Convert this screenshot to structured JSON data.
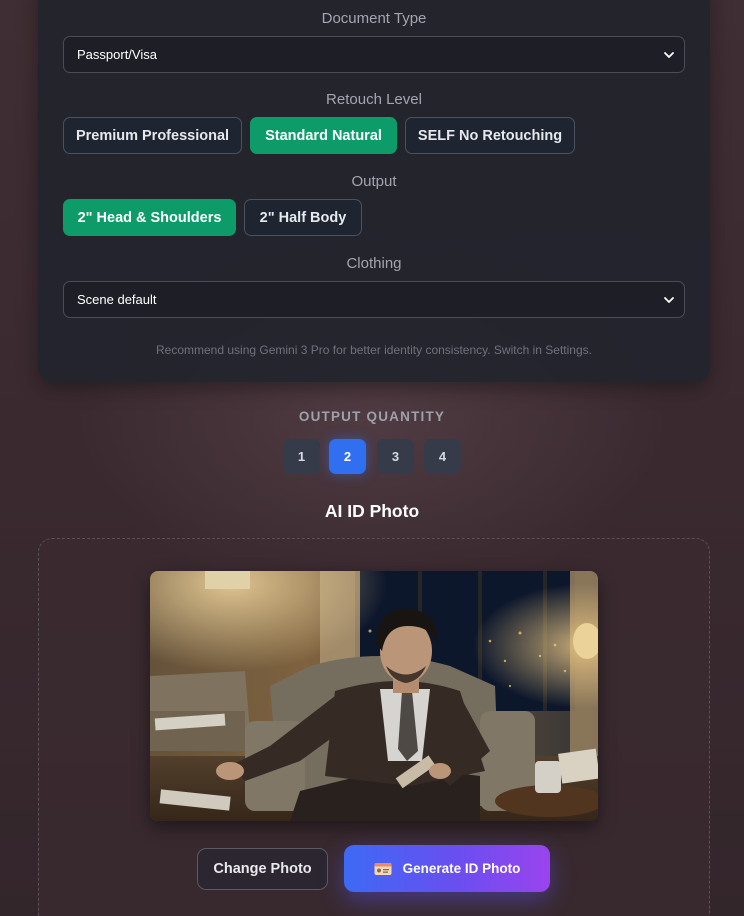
{
  "document_type": {
    "label": "Document Type",
    "selected": "Passport/Visa"
  },
  "retouch": {
    "label": "Retouch Level",
    "options": [
      "Premium Professional",
      "Standard Natural",
      "SELF No Retouching"
    ],
    "selected": "Standard Natural"
  },
  "output": {
    "label": "Output",
    "options": [
      "2\" Head & Shoulders",
      "2\" Half Body"
    ],
    "selected": "2\" Head & Shoulders"
  },
  "clothing": {
    "label": "Clothing",
    "selected": "Scene default"
  },
  "hint": "Recommend using Gemini 3 Pro for better identity consistency. Switch in Settings.",
  "quantity": {
    "label": "OUTPUT QUANTITY",
    "options": [
      "1",
      "2",
      "3",
      "4"
    ],
    "selected": "2"
  },
  "section_title": "AI ID Photo",
  "actions": {
    "change_photo": "Change Photo",
    "generate": "Generate ID Photo",
    "generate_icon": "id-card-icon"
  },
  "colors": {
    "accent_green": "#0e9b6a",
    "accent_blue": "#2f6ff0",
    "gradient_start": "#3d6af5",
    "gradient_end": "#9a44ee"
  }
}
